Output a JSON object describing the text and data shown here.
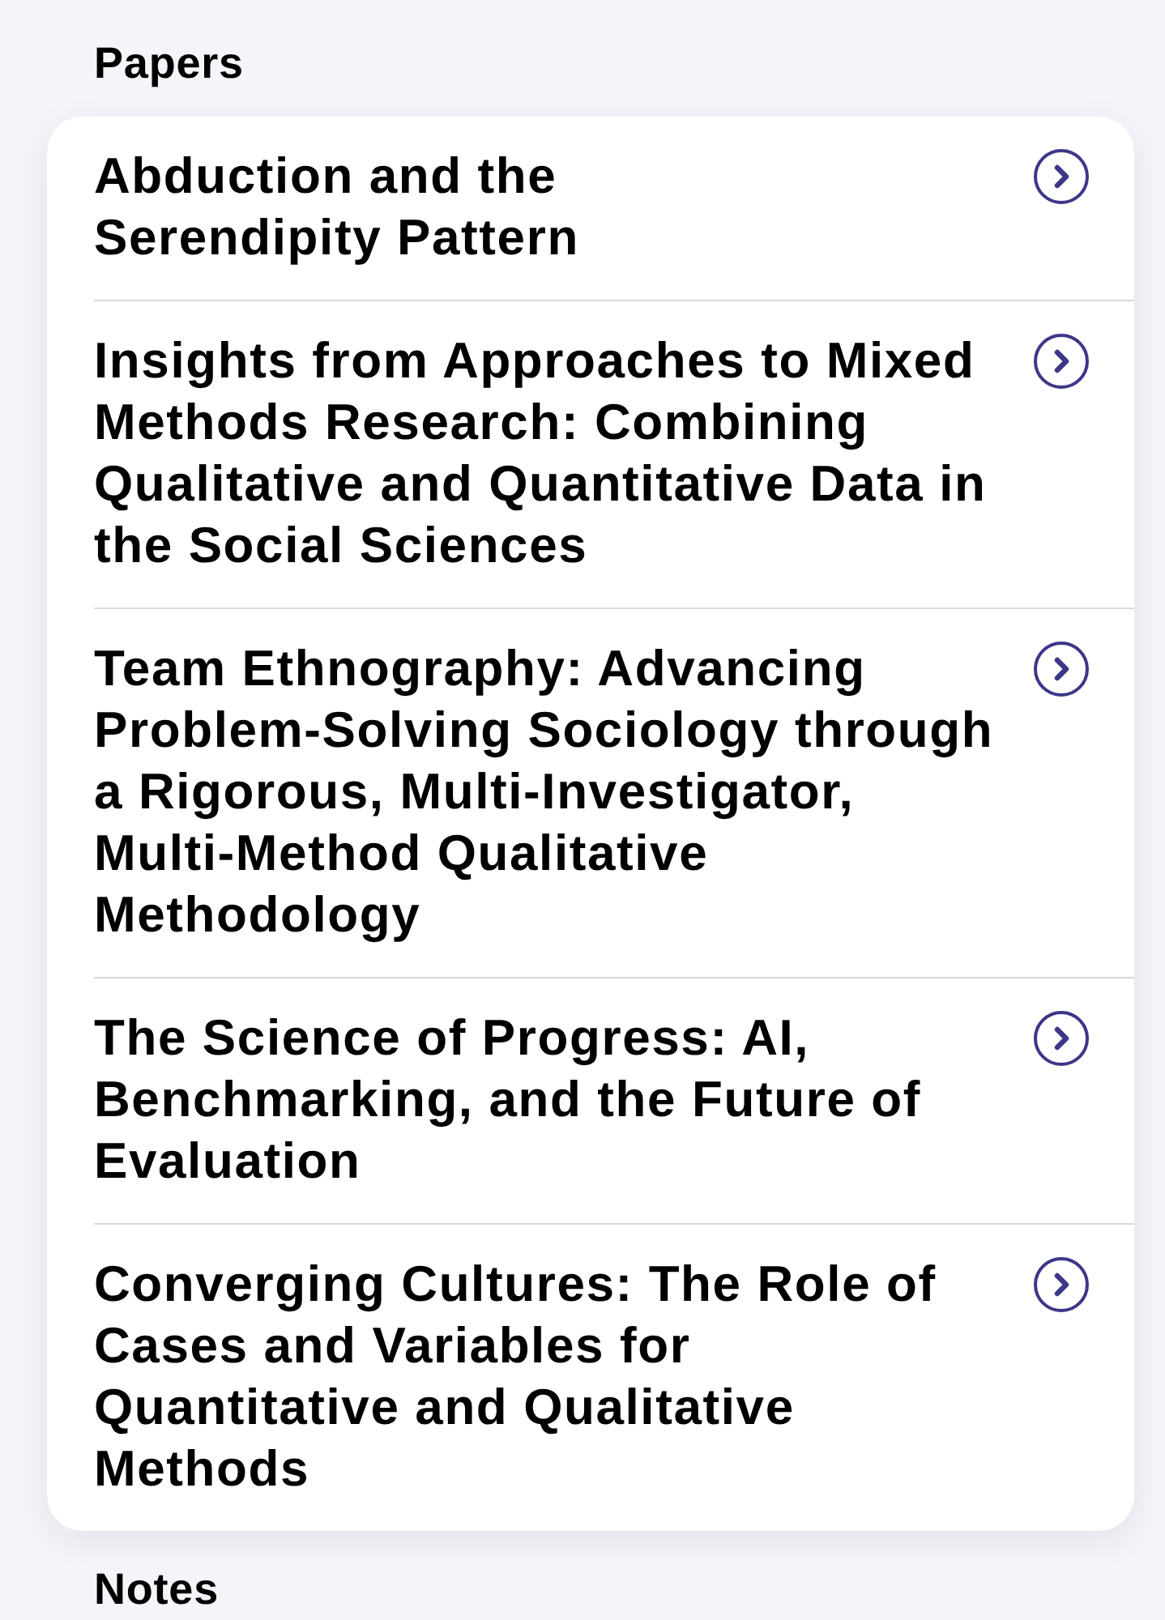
{
  "sections": [
    {
      "title": "Papers",
      "items": [
        {
          "title": "Abduction and the\nSerendipity Pattern"
        },
        {
          "title": "Insights from Approaches to Mixed Methods Research: Combining Qualitative and Quantitative Data in the Social Sciences"
        },
        {
          "title": "Team Ethnography: Advancing Problem-Solving Sociology through a Rigorous, Multi-Investigator, Multi-Method Qualitative Methodology"
        },
        {
          "title": "The Science of Progress: AI, Benchmarking, and the Future of Evaluation"
        },
        {
          "title": "Converging Cultures: The Role of Cases and Variables for Quantitative and Qualitative Methods"
        }
      ]
    },
    {
      "title": "Notes"
    }
  ]
}
